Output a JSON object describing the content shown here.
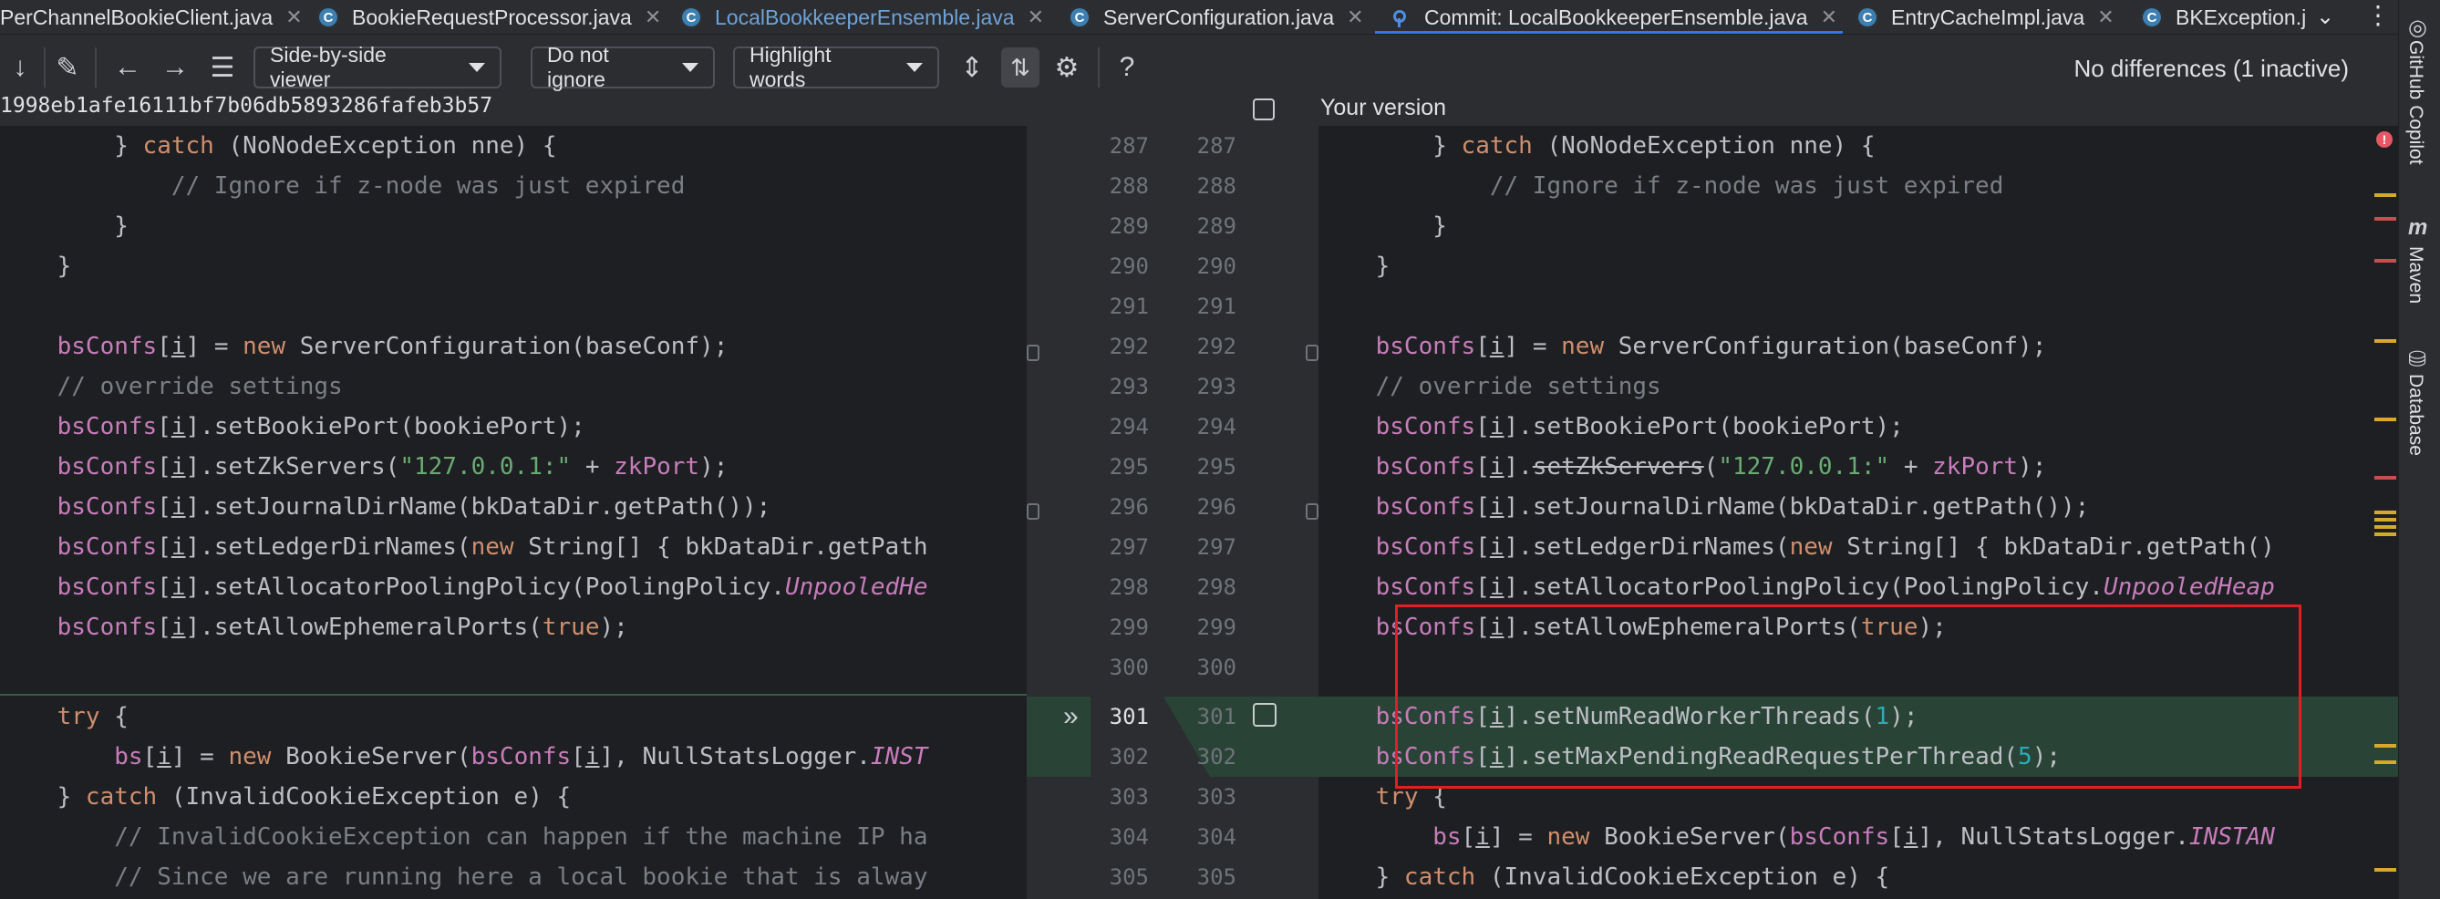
{
  "tabs": [
    {
      "label": "PerChannelBookieClient.java",
      "icon": "",
      "closable": true
    },
    {
      "label": "BookieRequestProcessor.java",
      "icon": "C",
      "closable": true
    },
    {
      "label": "LocalBookkeeperEnsemble.java",
      "icon": "C",
      "closable": true
    },
    {
      "label": "ServerConfiguration.java",
      "icon": "C",
      "closable": true
    },
    {
      "label": "Commit: LocalBookkeeperEnsemble.java",
      "icon": "commit",
      "closable": true
    },
    {
      "label": "EntryCacheImpl.java",
      "icon": "C",
      "closable": true
    },
    {
      "label": "BKException.j",
      "icon": "C",
      "closable": false
    }
  ],
  "toolbar": {
    "viewer_dropdown": "Side-by-side viewer",
    "ignore_dropdown": "Do not ignore",
    "highlight_dropdown": "Highlight words",
    "help_label": "?",
    "status": "No differences (1 inactive)"
  },
  "header": {
    "revision_hash": "1998eb1afe16111bf7b06db5893286fafeb3b57",
    "right_title": "Your version"
  },
  "gutter_numbers": {
    "left": [
      "287",
      "288",
      "289",
      "290",
      "291",
      "292",
      "293",
      "294",
      "295",
      "296",
      "297",
      "298",
      "299",
      "300",
      "301",
      "302",
      "303",
      "304",
      "305"
    ],
    "right": [
      "287",
      "288",
      "289",
      "290",
      "291",
      "292",
      "293",
      "294",
      "295",
      "296",
      "297",
      "298",
      "299",
      "300",
      "301",
      "302",
      "303",
      "304",
      "305"
    ]
  },
  "sidebar": {
    "copilot": "GitHub Copilot",
    "maven": "Maven",
    "database": "Database"
  },
  "colors": {
    "changed_bg": "#294436",
    "keyword": "#cf8e6d",
    "field": "#c77dbb",
    "string": "#6aab73",
    "number": "#2aacb8",
    "comment": "#7a7e85",
    "highlight_box": "#e02020"
  }
}
